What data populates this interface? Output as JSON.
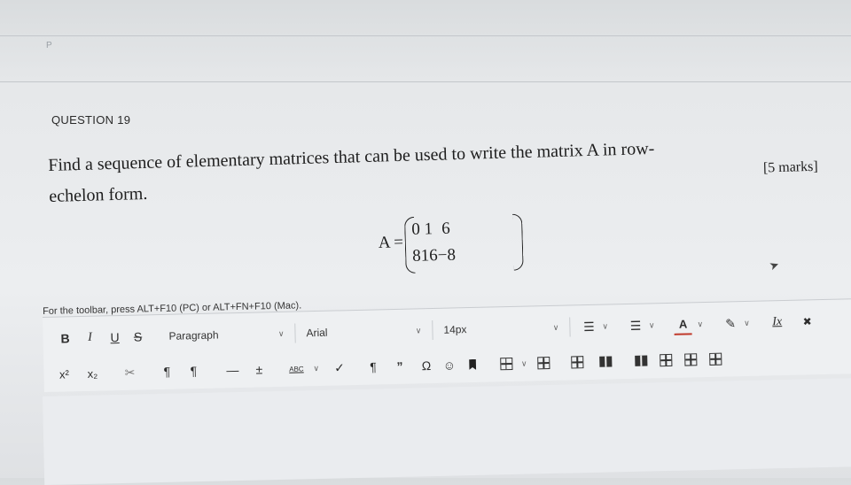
{
  "page": {
    "marker": "P"
  },
  "question": {
    "label": "QUESTION 19",
    "line1": "Find a sequence of elementary matrices that can be used to write the matrix A in row-",
    "line2": "echelon form.",
    "marks": "[5 marks]"
  },
  "matrix": {
    "lhs": "A =",
    "rows": [
      [
        "0",
        "1",
        "6"
      ],
      [
        "8",
        "16",
        "−8"
      ]
    ]
  },
  "editor": {
    "toolbar_hint": "For the toolbar, press ALT+F10 (PC) or ALT+FN+F10 (Mac).",
    "row1": {
      "bold": "B",
      "italic": "I",
      "underline": "U",
      "strike": "S",
      "paragraph": "Paragraph",
      "font": "Arial",
      "size": "14px",
      "bullet_list": "☰",
      "numbered_list": "☰",
      "text_color": "A",
      "highlight": "✎",
      "clear_format": "Ix",
      "remove": "✖"
    },
    "row2": {
      "superscript": "x²",
      "subscript": "x₂",
      "link": "✂",
      "ltr": "¶",
      "rtl": "¶",
      "hr": "—",
      "plus_minus": "±",
      "spellcheck": "ABC",
      "check": "✓",
      "paragraph_mark": "¶",
      "quote": "”",
      "omega": "Ω",
      "emoji": "☺"
    }
  }
}
